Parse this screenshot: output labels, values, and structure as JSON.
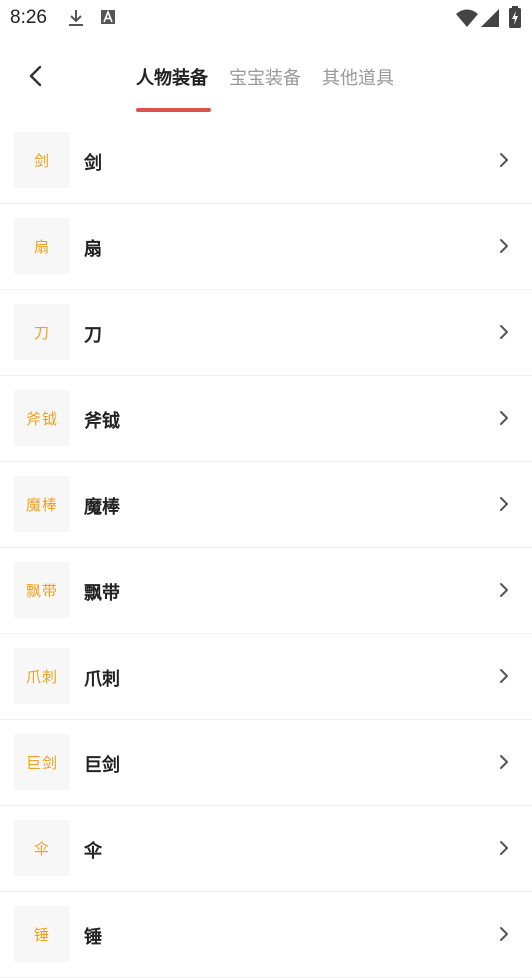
{
  "status_bar": {
    "time": "8:26",
    "icons": [
      "download-icon",
      "text-a-icon",
      "wifi-icon",
      "signal-icon",
      "battery-charging-icon"
    ]
  },
  "header": {
    "back_icon": "back-arrow-icon",
    "tabs": [
      {
        "label": "人物装备",
        "active": true
      },
      {
        "label": "宝宝装备",
        "active": false
      },
      {
        "label": "其他道具",
        "active": false
      }
    ],
    "indicator_color": "#d9534f"
  },
  "list": {
    "accent_color": "#f0a020",
    "items": [
      {
        "thumb": "剑",
        "label": "剑"
      },
      {
        "thumb": "扇",
        "label": "扇"
      },
      {
        "thumb": "刀",
        "label": "刀"
      },
      {
        "thumb": "斧钺",
        "label": "斧钺"
      },
      {
        "thumb": "魔棒",
        "label": "魔棒"
      },
      {
        "thumb": "飘带",
        "label": "飘带"
      },
      {
        "thumb": "爪刺",
        "label": "爪刺"
      },
      {
        "thumb": "巨剑",
        "label": "巨剑"
      },
      {
        "thumb": "伞",
        "label": "伞"
      },
      {
        "thumb": "锤",
        "label": "锤"
      }
    ]
  }
}
